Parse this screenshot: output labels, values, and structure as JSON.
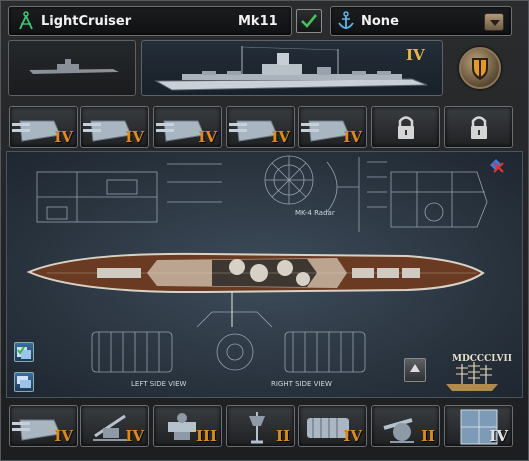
{
  "header": {
    "ship_name": "LightCruiser",
    "version": "Mk11",
    "role": "None",
    "tier": "IV"
  },
  "top_slots": [
    {
      "type": "turret",
      "tier": "IV",
      "locked": false
    },
    {
      "type": "turret",
      "tier": "IV",
      "locked": false
    },
    {
      "type": "turret",
      "tier": "IV",
      "locked": false
    },
    {
      "type": "turret",
      "tier": "IV",
      "locked": false
    },
    {
      "type": "turret",
      "tier": "IV",
      "locked": false
    },
    {
      "type": "locked",
      "tier": "",
      "locked": true
    },
    {
      "type": "locked",
      "tier": "",
      "locked": true
    }
  ],
  "bottom_slots": [
    {
      "type": "turret",
      "tier": "IV",
      "white": false
    },
    {
      "type": "aa-gun",
      "tier": "IV",
      "white": false
    },
    {
      "type": "fire-control",
      "tier": "III",
      "white": false
    },
    {
      "type": "radar",
      "tier": "II",
      "white": false
    },
    {
      "type": "engine",
      "tier": "IV",
      "white": false
    },
    {
      "type": "secondary",
      "tier": "II",
      "white": false
    },
    {
      "type": "armor",
      "tier": "IV",
      "white": true
    }
  ],
  "blueprint": {
    "left_side_view": "LEFT SIDE VIEW",
    "right_side_view": "RIGHT SIDE VIEW",
    "radar_label": "MK-4 Radar",
    "roman_flag": "MDCCCLVII"
  }
}
